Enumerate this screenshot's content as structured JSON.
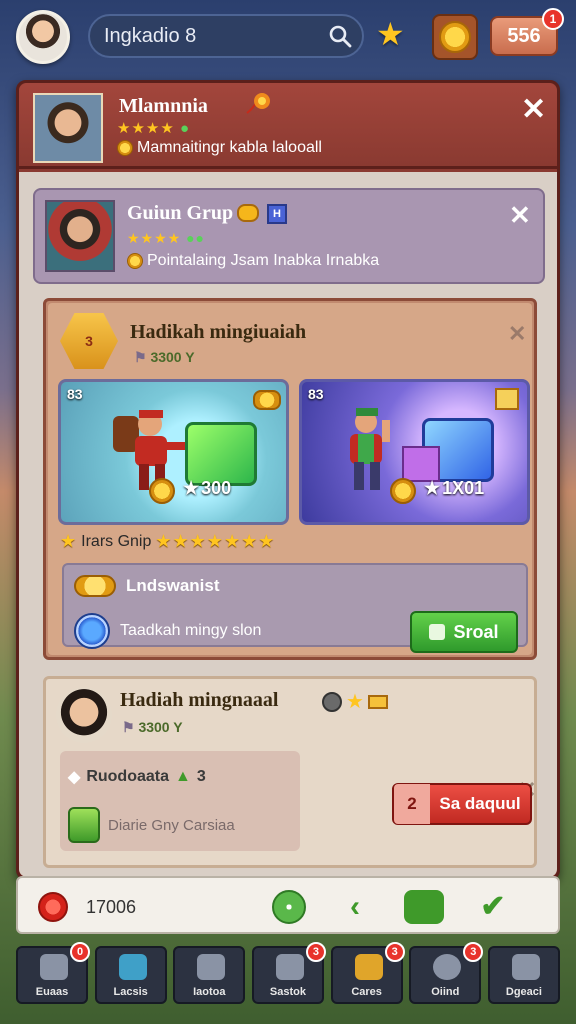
{
  "topbar": {
    "search_text": "Ingkadio 8",
    "currency_value": "556",
    "currency_badge": "1"
  },
  "panel": {
    "title": "Mlamnnia",
    "subtitle": "Mamnaitingr kabla lalooall"
  },
  "group_card": {
    "title": "Guiun Grup",
    "tiny_label": "H",
    "subtitle": "Pointalaing Jsam Inabka Irnabka"
  },
  "reward1": {
    "hex_label": "3",
    "title": "Hadikah mingiuaiah",
    "subtitle": "3300 Y",
    "tiles": [
      {
        "count": "83",
        "price": "300"
      },
      {
        "count": "83",
        "price": "1X01"
      }
    ],
    "stars_label": "Irars Gnip",
    "box_line1": "Lndswanist",
    "box_line2": "Taadkah mingy slon",
    "action_label": "Sroal"
  },
  "reward2": {
    "title": "Hadiah mingnaaal",
    "subtitle": "3300 Y",
    "left_line1": "Ruodoaata",
    "left_count": "3",
    "left_line2": "Diarie Gny Carsiaa",
    "action_prefix": "2",
    "action_label": "Sa daquul"
  },
  "statusbar": {
    "value": "17006"
  },
  "nav": [
    {
      "label": "Euaas",
      "badge": "0"
    },
    {
      "label": "Lacsis",
      "badge": ""
    },
    {
      "label": "Iaotoa",
      "badge": ""
    },
    {
      "label": "Sastok",
      "badge": "3"
    },
    {
      "label": "Cares",
      "badge": "3"
    },
    {
      "label": "Oiind",
      "badge": "3"
    },
    {
      "label": "Dgeaci",
      "badge": ""
    }
  ]
}
